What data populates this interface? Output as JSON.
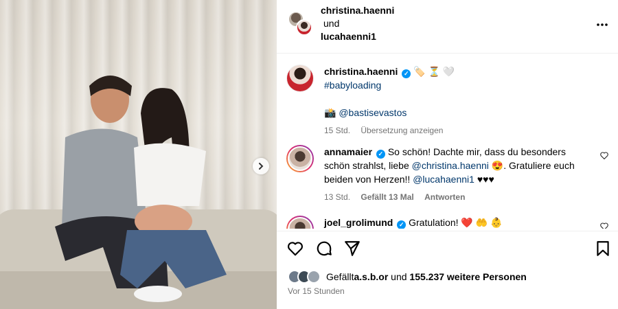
{
  "post_owners": {
    "user1": "christina.haenni",
    "conjunction": "und",
    "user2": "lucahaenni1"
  },
  "caption": {
    "username": "christina.haenni",
    "emojis": "🏷️ ⏳ 🤍",
    "hashtag": "#babyloading",
    "credit_emoji": "📸",
    "mention": "@bastisevastos",
    "time": "15 Std.",
    "translate": "Übersetzung anzeigen"
  },
  "comments": [
    {
      "username": "annamaier",
      "text_1": "So schön! Dachte mir, dass du besonders schön strahlst, liebe ",
      "mention_1": "@christina.haenni",
      "text_2": " 😍. Gratuliere euch beiden von Herzen!! ",
      "mention_2": "@lucahaenni1",
      "text_3": " ♥♥♥",
      "time": "13 Std.",
      "likes": "Gefällt 13 Mal",
      "reply": "Antworten"
    },
    {
      "username": "joel_grolimund",
      "text_1": "Gratulation! ❤️ 🤲 👶"
    }
  ],
  "likes": {
    "prefix": "Gefällt ",
    "user": "a.s.b.or",
    "mid": " und ",
    "count": "155.237 weitere Personen"
  },
  "timestamp": "Vor 15 Stunden",
  "icons": [
    "more-icon",
    "heart-icon",
    "comment-icon",
    "share-icon",
    "bookmark-icon",
    "verified-icon",
    "chevron-right-icon"
  ],
  "colors": {
    "verified": "#0095f6",
    "link": "#00376b",
    "muted": "#737373"
  }
}
